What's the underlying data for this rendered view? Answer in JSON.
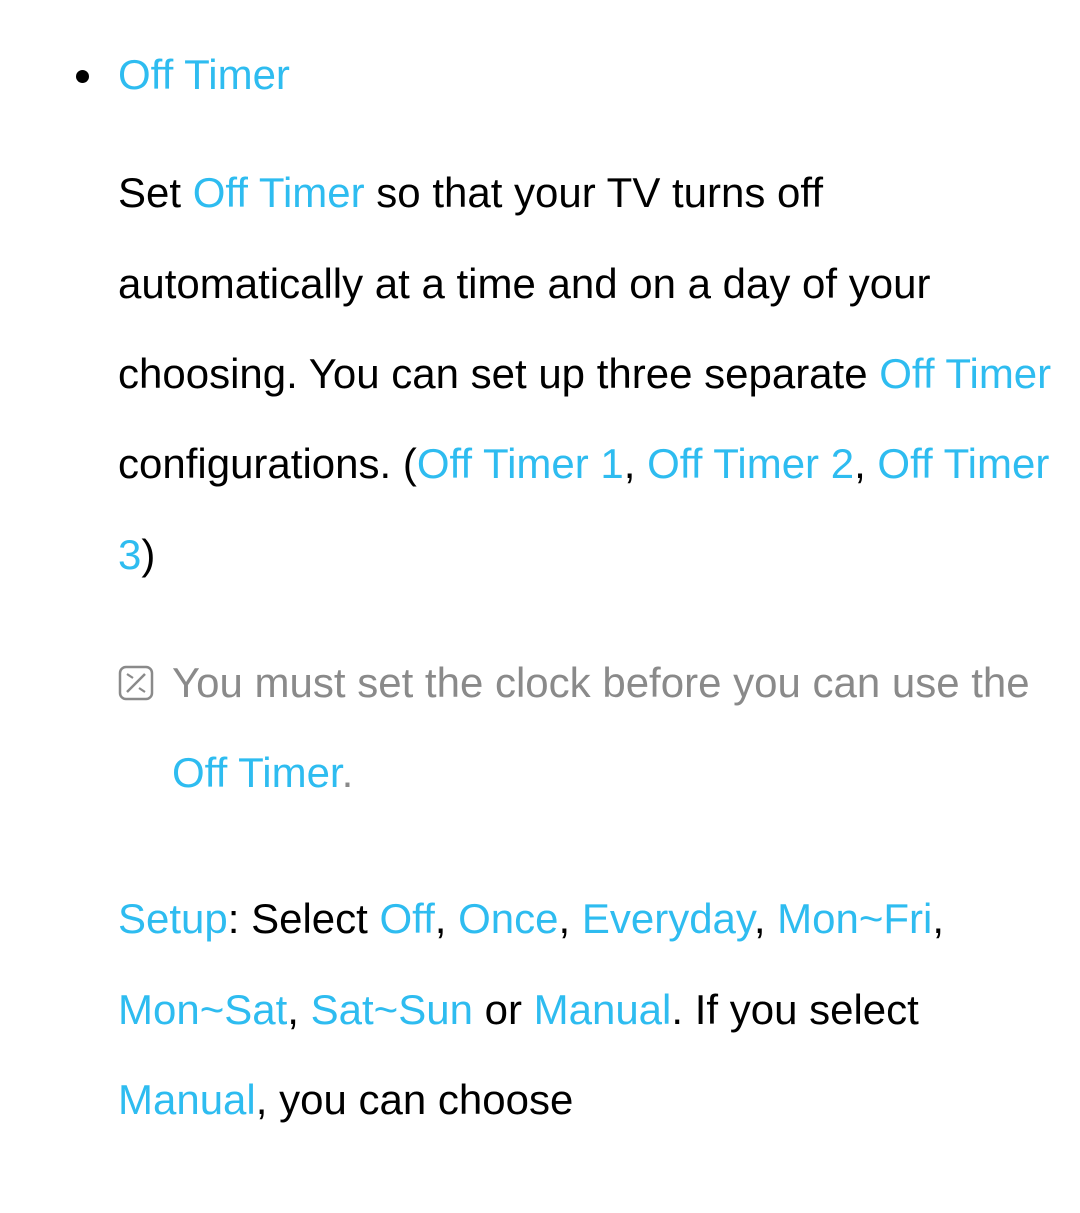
{
  "heading": "Off Timer",
  "p1": {
    "t0": "Set ",
    "k0": "Off Timer",
    "t1": " so that your TV turns off automatically at a time and on a day of your choosing. You can set up three separate ",
    "k1": "Off Timer",
    "t2": " configurations. (",
    "k2": "Off Timer 1",
    "t3": ", ",
    "k3": "Off Timer 2",
    "t4": ", ",
    "k4": "Off Timer 3",
    "t5": ")"
  },
  "note": {
    "t0": "You must set the clock before you can use the ",
    "k0": "Off Timer",
    "t1": "."
  },
  "p2": {
    "k0": "Setup",
    "t0": ": Select ",
    "k1": "Off",
    "t1": ", ",
    "k2": "Once",
    "t2": ", ",
    "k3": "Everyday",
    "t3": ", ",
    "k4": "Mon~Fri",
    "t4": ", ",
    "k5": "Mon~Sat",
    "t5": ", ",
    "k6": "Sat~Sun",
    "t6": " or ",
    "k7": "Manual",
    "t7": ". If you select ",
    "k8": "Manual",
    "t8": ", you can choose"
  }
}
